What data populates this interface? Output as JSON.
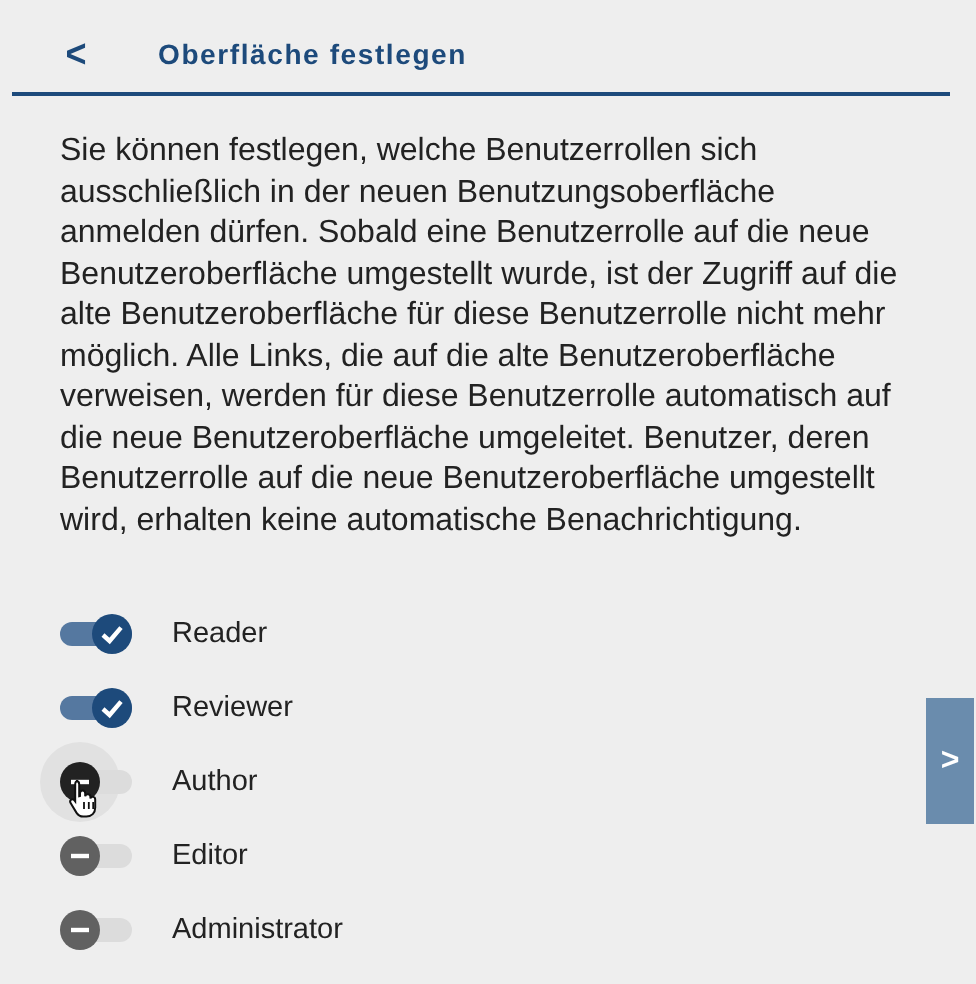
{
  "header": {
    "back": "<",
    "title": "Oberfläche festlegen"
  },
  "description": "Sie können festlegen, welche Benutzerrollen sich ausschließlich in der neuen Benutzungsoberfläche anmelden dürfen. Sobald eine Benutzerrolle auf die neue Benutzeroberfläche umgestellt wurde, ist der Zugriff auf die alte Benutzeroberfläche für diese Benutzerrolle nicht mehr möglich. Alle Links, die auf die alte Benutzeroberfläche verweisen, werden für diese Benutzerrolle automatisch auf die neue Benutzeroberfläche umgeleitet. Benutzer, deren Benutzerrolle auf die neue Benutzeroberfläche umgestellt wird, erhalten keine automatische Benachrichtigung.",
  "roles": [
    {
      "label": "Reader",
      "on": true,
      "hovered": false
    },
    {
      "label": "Reviewer",
      "on": true,
      "hovered": false
    },
    {
      "label": "Author",
      "on": false,
      "hovered": true
    },
    {
      "label": "Editor",
      "on": false,
      "hovered": false
    },
    {
      "label": "Administrator",
      "on": false,
      "hovered": false
    }
  ],
  "side_tab": {
    "icon": ">"
  }
}
